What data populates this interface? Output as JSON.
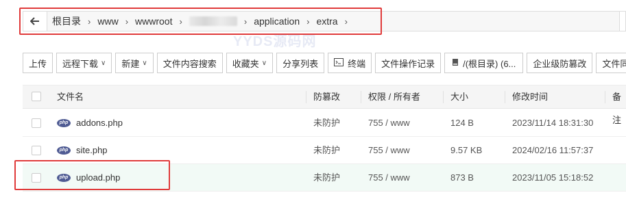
{
  "breadcrumb": {
    "items": [
      "根目录",
      "www",
      "wwwroot",
      "",
      "application",
      "extra"
    ],
    "separator": "›"
  },
  "watermark": "YYDS源码网",
  "toolbar": {
    "buttons": [
      {
        "label": "上传"
      },
      {
        "label": "远程下载",
        "dropdown": true
      },
      {
        "label": "新建",
        "dropdown": true
      },
      {
        "label": "文件内容搜索"
      },
      {
        "label": "收藏夹",
        "dropdown": true
      },
      {
        "label": "分享列表"
      },
      {
        "label": "终端",
        "icon": "terminal-icon"
      },
      {
        "label": "文件操作记录"
      },
      {
        "label": "/(根目录) (6...",
        "icon": "disk-icon"
      },
      {
        "label": "企业级防篡改"
      },
      {
        "label": "文件同"
      }
    ]
  },
  "table": {
    "headers": [
      "文件名",
      "防篡改",
      "权限 / 所有者",
      "大小",
      "修改时间",
      "备注"
    ],
    "rows": [
      {
        "name": "addons.php",
        "tamper": "未防护",
        "perm": "755 / www",
        "size": "124 B",
        "mtime": "2023/11/14 18:31:30"
      },
      {
        "name": "site.php",
        "tamper": "未防护",
        "perm": "755 / www",
        "size": "9.57 KB",
        "mtime": "2024/02/16 11:57:37"
      },
      {
        "name": "upload.php",
        "tamper": "未防护",
        "perm": "755 / www",
        "size": "873 B",
        "mtime": "2023/11/05 15:18:52"
      }
    ],
    "file_icon": "php-file-icon",
    "highlighted_row": 2
  },
  "colors": {
    "annotation_red": "#e03a3a",
    "php_badge": "#4f5b93",
    "row_highlight": "#f2faf6"
  }
}
